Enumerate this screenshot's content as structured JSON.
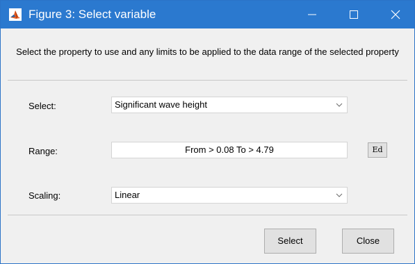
{
  "window": {
    "title": "Figure 3: Select variable",
    "accent_color": "#2b79cf",
    "icon": "matlab-icon"
  },
  "instructions": "Select the property to use and any limits to be applied to the data range of the selected property",
  "form": {
    "select_label": "Select:",
    "select_value": "Significant wave height",
    "range_label": "Range:",
    "range_value": "From > 0.08 To > 4.79",
    "edit_button": "Ed",
    "scaling_label": "Scaling:",
    "scaling_value": "Linear"
  },
  "buttons": {
    "select": "Select",
    "close": "Close"
  }
}
